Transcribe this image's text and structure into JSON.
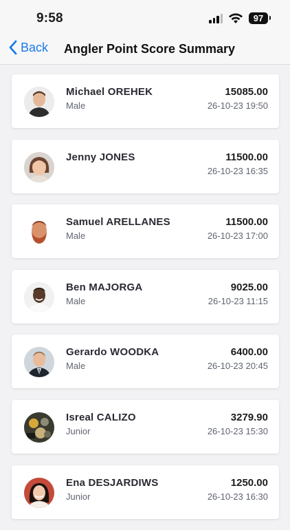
{
  "status_bar": {
    "time": "9:58",
    "battery": "97",
    "icons": [
      "cellular-signal-icon",
      "wifi-icon",
      "battery-icon"
    ]
  },
  "nav": {
    "back_label": "Back",
    "title": "Angler Point Score Summary"
  },
  "colors": {
    "accent": "#1a7ae8",
    "background": "#f2f2f4",
    "card": "#ffffff"
  },
  "entries": [
    {
      "name": "Michael OREHEK",
      "category": "Male",
      "score": "15085.00",
      "datetime": "26-10-23 19:50",
      "avatar": "avatar-photo"
    },
    {
      "name": "Jenny JONES",
      "category": "",
      "score": "11500.00",
      "datetime": "26-10-23 16:35",
      "avatar": "avatar-photo"
    },
    {
      "name": "Samuel ARELLANES",
      "category": "Male",
      "score": "11500.00",
      "datetime": "26-10-23 17:00",
      "avatar": "avatar-photo"
    },
    {
      "name": "Ben MAJORGA",
      "category": "Male",
      "score": "9025.00",
      "datetime": "26-10-23 11:15",
      "avatar": "avatar-photo"
    },
    {
      "name": "Gerardo WOODKA",
      "category": "Male",
      "score": "6400.00",
      "datetime": "26-10-23 20:45",
      "avatar": "avatar-photo"
    },
    {
      "name": "Isreal CALIZO",
      "category": "Junior",
      "score": "3279.90",
      "datetime": "26-10-23 15:30",
      "avatar": "avatar-photo"
    },
    {
      "name": "Ena DESJARDIWS",
      "category": "Junior",
      "score": "1250.00",
      "datetime": "26-10-23 16:30",
      "avatar": "avatar-photo"
    }
  ]
}
